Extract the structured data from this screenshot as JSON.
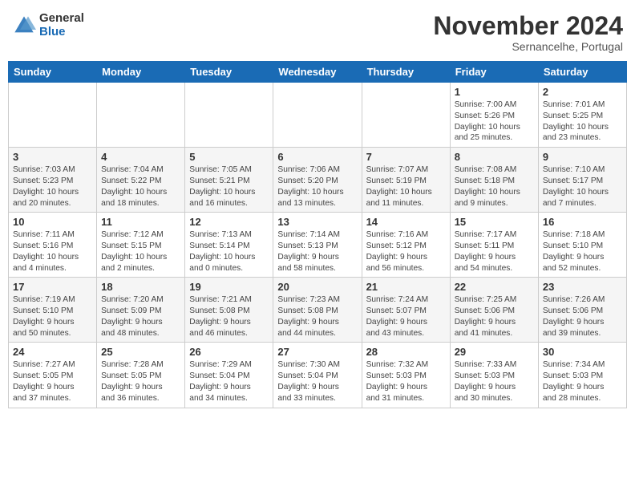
{
  "header": {
    "logo_general": "General",
    "logo_blue": "Blue",
    "month_title": "November 2024",
    "location": "Sernancelhe, Portugal"
  },
  "weekdays": [
    "Sunday",
    "Monday",
    "Tuesday",
    "Wednesday",
    "Thursday",
    "Friday",
    "Saturday"
  ],
  "weeks": [
    [
      {
        "day": "",
        "info": ""
      },
      {
        "day": "",
        "info": ""
      },
      {
        "day": "",
        "info": ""
      },
      {
        "day": "",
        "info": ""
      },
      {
        "day": "",
        "info": ""
      },
      {
        "day": "1",
        "info": "Sunrise: 7:00 AM\nSunset: 5:26 PM\nDaylight: 10 hours\nand 25 minutes."
      },
      {
        "day": "2",
        "info": "Sunrise: 7:01 AM\nSunset: 5:25 PM\nDaylight: 10 hours\nand 23 minutes."
      }
    ],
    [
      {
        "day": "3",
        "info": "Sunrise: 7:03 AM\nSunset: 5:23 PM\nDaylight: 10 hours\nand 20 minutes."
      },
      {
        "day": "4",
        "info": "Sunrise: 7:04 AM\nSunset: 5:22 PM\nDaylight: 10 hours\nand 18 minutes."
      },
      {
        "day": "5",
        "info": "Sunrise: 7:05 AM\nSunset: 5:21 PM\nDaylight: 10 hours\nand 16 minutes."
      },
      {
        "day": "6",
        "info": "Sunrise: 7:06 AM\nSunset: 5:20 PM\nDaylight: 10 hours\nand 13 minutes."
      },
      {
        "day": "7",
        "info": "Sunrise: 7:07 AM\nSunset: 5:19 PM\nDaylight: 10 hours\nand 11 minutes."
      },
      {
        "day": "8",
        "info": "Sunrise: 7:08 AM\nSunset: 5:18 PM\nDaylight: 10 hours\nand 9 minutes."
      },
      {
        "day": "9",
        "info": "Sunrise: 7:10 AM\nSunset: 5:17 PM\nDaylight: 10 hours\nand 7 minutes."
      }
    ],
    [
      {
        "day": "10",
        "info": "Sunrise: 7:11 AM\nSunset: 5:16 PM\nDaylight: 10 hours\nand 4 minutes."
      },
      {
        "day": "11",
        "info": "Sunrise: 7:12 AM\nSunset: 5:15 PM\nDaylight: 10 hours\nand 2 minutes."
      },
      {
        "day": "12",
        "info": "Sunrise: 7:13 AM\nSunset: 5:14 PM\nDaylight: 10 hours\nand 0 minutes."
      },
      {
        "day": "13",
        "info": "Sunrise: 7:14 AM\nSunset: 5:13 PM\nDaylight: 9 hours\nand 58 minutes."
      },
      {
        "day": "14",
        "info": "Sunrise: 7:16 AM\nSunset: 5:12 PM\nDaylight: 9 hours\nand 56 minutes."
      },
      {
        "day": "15",
        "info": "Sunrise: 7:17 AM\nSunset: 5:11 PM\nDaylight: 9 hours\nand 54 minutes."
      },
      {
        "day": "16",
        "info": "Sunrise: 7:18 AM\nSunset: 5:10 PM\nDaylight: 9 hours\nand 52 minutes."
      }
    ],
    [
      {
        "day": "17",
        "info": "Sunrise: 7:19 AM\nSunset: 5:10 PM\nDaylight: 9 hours\nand 50 minutes."
      },
      {
        "day": "18",
        "info": "Sunrise: 7:20 AM\nSunset: 5:09 PM\nDaylight: 9 hours\nand 48 minutes."
      },
      {
        "day": "19",
        "info": "Sunrise: 7:21 AM\nSunset: 5:08 PM\nDaylight: 9 hours\nand 46 minutes."
      },
      {
        "day": "20",
        "info": "Sunrise: 7:23 AM\nSunset: 5:08 PM\nDaylight: 9 hours\nand 44 minutes."
      },
      {
        "day": "21",
        "info": "Sunrise: 7:24 AM\nSunset: 5:07 PM\nDaylight: 9 hours\nand 43 minutes."
      },
      {
        "day": "22",
        "info": "Sunrise: 7:25 AM\nSunset: 5:06 PM\nDaylight: 9 hours\nand 41 minutes."
      },
      {
        "day": "23",
        "info": "Sunrise: 7:26 AM\nSunset: 5:06 PM\nDaylight: 9 hours\nand 39 minutes."
      }
    ],
    [
      {
        "day": "24",
        "info": "Sunrise: 7:27 AM\nSunset: 5:05 PM\nDaylight: 9 hours\nand 37 minutes."
      },
      {
        "day": "25",
        "info": "Sunrise: 7:28 AM\nSunset: 5:05 PM\nDaylight: 9 hours\nand 36 minutes."
      },
      {
        "day": "26",
        "info": "Sunrise: 7:29 AM\nSunset: 5:04 PM\nDaylight: 9 hours\nand 34 minutes."
      },
      {
        "day": "27",
        "info": "Sunrise: 7:30 AM\nSunset: 5:04 PM\nDaylight: 9 hours\nand 33 minutes."
      },
      {
        "day": "28",
        "info": "Sunrise: 7:32 AM\nSunset: 5:03 PM\nDaylight: 9 hours\nand 31 minutes."
      },
      {
        "day": "29",
        "info": "Sunrise: 7:33 AM\nSunset: 5:03 PM\nDaylight: 9 hours\nand 30 minutes."
      },
      {
        "day": "30",
        "info": "Sunrise: 7:34 AM\nSunset: 5:03 PM\nDaylight: 9 hours\nand 28 minutes."
      }
    ]
  ]
}
